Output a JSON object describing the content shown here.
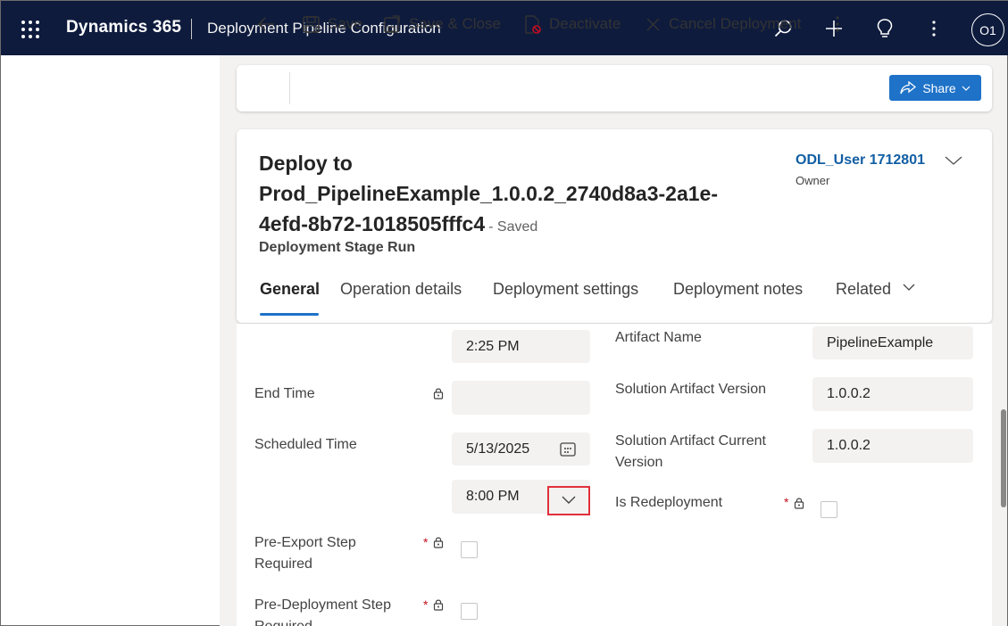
{
  "topbar": {
    "app_name": "Dynamics 365",
    "page_name": "Deployment Pipeline Configuration",
    "avatar_initials": "O1"
  },
  "commands": {
    "save": "Save",
    "save_close": "Save & Close",
    "deactivate": "Deactivate",
    "cancel_deployment": "Cancel Deployment",
    "share": "Share"
  },
  "record": {
    "title_line1": "Deploy to",
    "title_line2": "Prod_PipelineExample_1.0.0.2_2740d8a3-2a1e-",
    "title_line3": "4efd-8b72-1018505fffc4",
    "saved_status": "- Saved",
    "entity": "Deployment Stage Run",
    "owner_name": "ODL_User 1712801",
    "owner_label": "Owner"
  },
  "tabs": [
    {
      "label": "General",
      "active": true
    },
    {
      "label": "Operation details"
    },
    {
      "label": "Deployment settings"
    },
    {
      "label": "Deployment notes"
    },
    {
      "label": "Related"
    }
  ],
  "form": {
    "start_time_value": "2:25 PM",
    "end_time_label": "End Time",
    "end_time_value": "",
    "scheduled_time_label": "Scheduled Time",
    "scheduled_date_value": "5/13/2025",
    "scheduled_time_value": "8:00 PM",
    "pre_export_label_1": "Pre-Export Step",
    "pre_export_label_2": "Required",
    "pre_deploy_label_1": "Pre-Deployment Step",
    "pre_deploy_label_2": "Required",
    "artifact_name_label": "Artifact Name",
    "artifact_name_value": "PipelineExample",
    "solution_version_label": "Solution Artifact Version",
    "solution_version_value": "1.0.0.2",
    "current_version_label_1": "Solution Artifact Current",
    "current_version_label_2": "Version",
    "current_version_value": "1.0.0.2",
    "redeploy_label": "Is Redeployment",
    "required_marker": "*"
  },
  "colors": {
    "topbar": "#0e1b3d",
    "accent": "#1e72c8",
    "owner_link": "#115ea3",
    "highlight": "#e0303a",
    "required": "#c50f1f"
  }
}
